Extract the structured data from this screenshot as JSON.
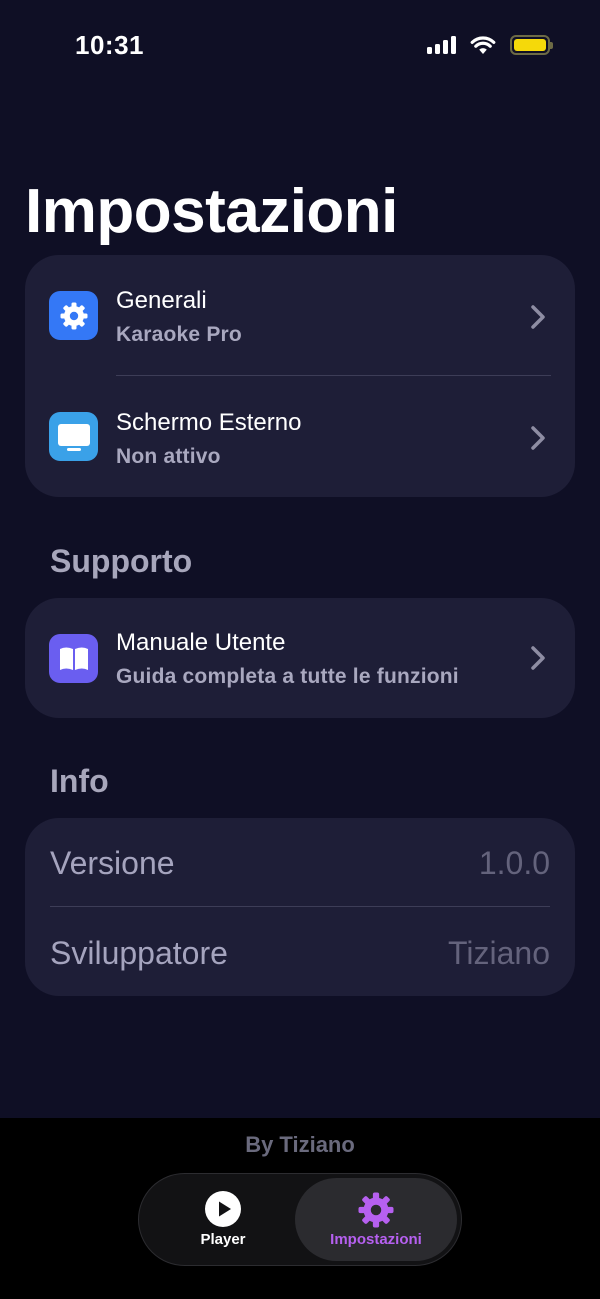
{
  "status_bar": {
    "time": "10:31"
  },
  "title": "Impostazioni",
  "general_section": {
    "items": [
      {
        "title": "Generali",
        "subtitle": "Karaoke Pro",
        "icon": "gear-icon",
        "icon_color": "#3478f6"
      },
      {
        "title": "Schermo Esterno",
        "subtitle": "Non attivo",
        "icon": "display-icon",
        "icon_color": "#3aa1e8"
      }
    ]
  },
  "support_section": {
    "header": "Supporto",
    "items": [
      {
        "title": "Manuale Utente",
        "subtitle": "Guida completa a tutte le funzioni",
        "icon": "book-icon",
        "icon_color": "#6a5ef0"
      }
    ]
  },
  "info_section": {
    "header": "Info",
    "rows": [
      {
        "label": "Versione",
        "value": "1.0.0"
      },
      {
        "label": "Sviluppatore",
        "value": "Tiziano"
      }
    ]
  },
  "footer": {
    "byline": "By Tiziano"
  },
  "tabbar": {
    "tabs": [
      {
        "label": "Player",
        "icon": "play-icon",
        "selected": false
      },
      {
        "label": "Impostazioni",
        "icon": "gear-icon",
        "selected": true
      }
    ]
  },
  "colors": {
    "background": "#0f0f25",
    "card": "#1e1e37",
    "accent": "#b660f0",
    "battery": "#f5d90a"
  }
}
